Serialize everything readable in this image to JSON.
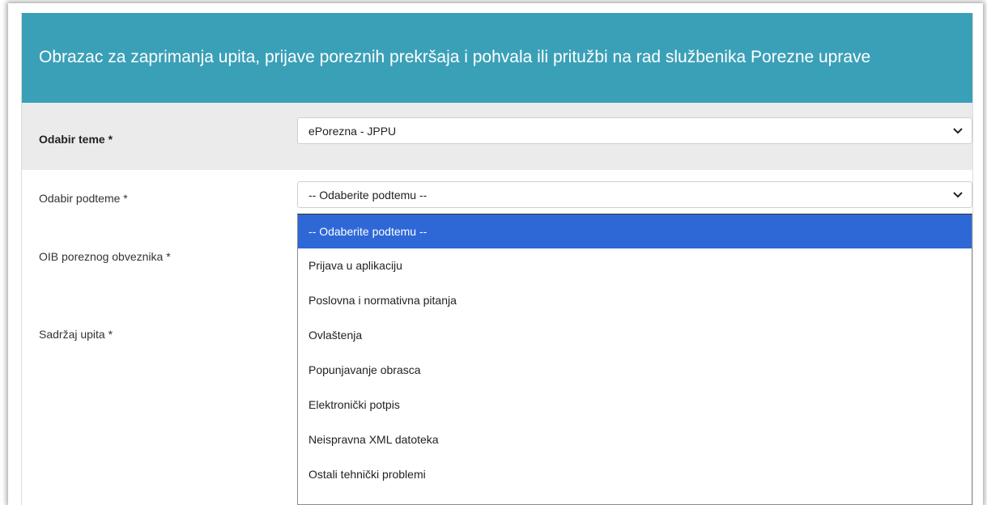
{
  "header": {
    "title": "Obrazac za zaprimanja upita, prijave poreznih prekršaja i pohvala ili pritužbi na rad službenika Porezne uprave"
  },
  "form": {
    "topic": {
      "label": "Odabir teme *",
      "value": "ePorezna - JPPU"
    },
    "subtopic": {
      "label": "Odabir podteme *",
      "value": "-- Odaberite podtemu --"
    },
    "oib": {
      "label": "OIB poreznog obveznika *"
    },
    "content": {
      "label": "Sadržaj upita *"
    }
  },
  "dropdown": {
    "options": [
      "-- Odaberite podtemu --",
      "Prijava u aplikaciju",
      "Poslovna i normativna pitanja",
      "Ovlaštenja",
      "Popunjavanje obrasca",
      "Elektronički potpis",
      "Neispravna XML datoteka",
      "Ostali tehnički problemi"
    ],
    "selected_index": 0
  },
  "colors": {
    "header_bg": "#3aa0b8",
    "selected_option_bg": "#2e68d6",
    "topic_row_bg": "#ebebeb"
  },
  "icons": {
    "select_arrow": "chevron-down-icon"
  }
}
